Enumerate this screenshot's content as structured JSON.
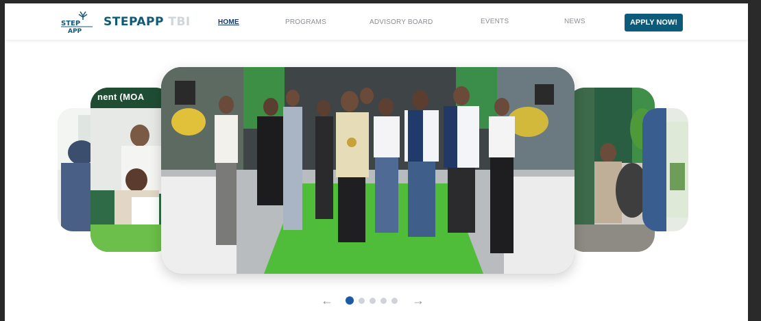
{
  "brand": {
    "part1": "STEPAPP",
    "part2": " TBI"
  },
  "nav": [
    {
      "label": "HOME",
      "active": true
    },
    {
      "label": "PROGRAMS",
      "active": false
    },
    {
      "label": "ADVISORY BOARD",
      "active": false
    },
    {
      "label": "EVENTS",
      "active": false
    },
    {
      "label": "NEWS",
      "active": false
    }
  ],
  "apply_label": "APPLY NOW!",
  "carousel": {
    "slide_caption_left": "nent (MOA",
    "arrow_prev": "←",
    "arrow_next": "→",
    "dot_count": 5,
    "active_dot": 0
  },
  "colors": {
    "primary": "#0c5b7a",
    "dot_active": "#1a5aa6",
    "dot_inactive": "#cfd3d7"
  }
}
